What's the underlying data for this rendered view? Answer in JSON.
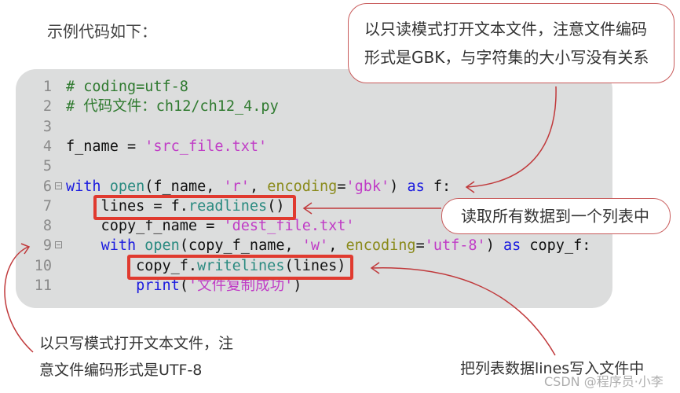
{
  "intro_text": "示例代码如下：",
  "code": {
    "lines": [
      {
        "num": "1",
        "fold": false,
        "tokens": [
          {
            "t": "# coding=utf-8",
            "c": "comment"
          }
        ]
      },
      {
        "num": "2",
        "fold": false,
        "tokens": [
          {
            "t": "# 代码文件：ch12/ch12_4.py",
            "c": "comment"
          }
        ]
      },
      {
        "num": "3",
        "fold": false,
        "tokens": []
      },
      {
        "num": "4",
        "fold": false,
        "tokens": [
          {
            "t": "f_name = ",
            "c": "plain"
          },
          {
            "t": "'src_file.txt'",
            "c": "str"
          }
        ]
      },
      {
        "num": "5",
        "fold": false,
        "tokens": []
      },
      {
        "num": "6",
        "fold": true,
        "tokens": [
          {
            "t": "with",
            "c": "kw"
          },
          {
            "t": " ",
            "c": "plain"
          },
          {
            "t": "open",
            "c": "fn"
          },
          {
            "t": "(f_name, ",
            "c": "plain"
          },
          {
            "t": "'r'",
            "c": "str"
          },
          {
            "t": ", ",
            "c": "plain"
          },
          {
            "t": "encoding",
            "c": "param"
          },
          {
            "t": "=",
            "c": "plain"
          },
          {
            "t": "'gbk'",
            "c": "str"
          },
          {
            "t": ") ",
            "c": "plain"
          },
          {
            "t": "as",
            "c": "kw"
          },
          {
            "t": " f:",
            "c": "plain"
          }
        ]
      },
      {
        "num": "7",
        "fold": false,
        "tokens": [
          {
            "t": "    lines = f.",
            "c": "plain"
          },
          {
            "t": "readlines",
            "c": "fn"
          },
          {
            "t": "()",
            "c": "plain"
          }
        ]
      },
      {
        "num": "8",
        "fold": false,
        "tokens": [
          {
            "t": "    copy_f_name = ",
            "c": "plain"
          },
          {
            "t": "'dest_file.txt'",
            "c": "str"
          }
        ]
      },
      {
        "num": "9",
        "fold": true,
        "tokens": [
          {
            "t": "    ",
            "c": "plain"
          },
          {
            "t": "with",
            "c": "kw"
          },
          {
            "t": " ",
            "c": "plain"
          },
          {
            "t": "open",
            "c": "fn"
          },
          {
            "t": "(copy_f_name, ",
            "c": "plain"
          },
          {
            "t": "'w'",
            "c": "str"
          },
          {
            "t": ", ",
            "c": "plain"
          },
          {
            "t": "encoding",
            "c": "param"
          },
          {
            "t": "=",
            "c": "plain"
          },
          {
            "t": "'utf-8'",
            "c": "str"
          },
          {
            "t": ") ",
            "c": "plain"
          },
          {
            "t": "as",
            "c": "kw"
          },
          {
            "t": " copy_f:",
            "c": "plain"
          }
        ]
      },
      {
        "num": "10",
        "fold": false,
        "tokens": [
          {
            "t": "        copy_f.",
            "c": "plain"
          },
          {
            "t": "writelines",
            "c": "fn"
          },
          {
            "t": "(lines)",
            "c": "plain"
          }
        ]
      },
      {
        "num": "11",
        "fold": false,
        "tokens": [
          {
            "t": "        ",
            "c": "plain"
          },
          {
            "t": "print",
            "c": "kw"
          },
          {
            "t": "(",
            "c": "plain"
          },
          {
            "t": "'文件复制成功'",
            "c": "str"
          },
          {
            "t": ")",
            "c": "plain"
          }
        ]
      }
    ]
  },
  "callouts": {
    "top_line1": "以只读模式打开文本文件，注意文件编码",
    "top_line2": "形式是GBK，与字符集的大小写没有关系",
    "mid": "读取所有数据到一个列表中",
    "left_line1": "以只写模式打开文本文件，注",
    "left_line2": "意文件编码形式是UTF-8",
    "right": "把列表数据lines写入文件中"
  },
  "watermark": "CSDN @程序员·小李",
  "colors": {
    "highlight_box": "#e03a2f",
    "arrow": "#c0393b",
    "panel_bg": "#dcdddd"
  }
}
